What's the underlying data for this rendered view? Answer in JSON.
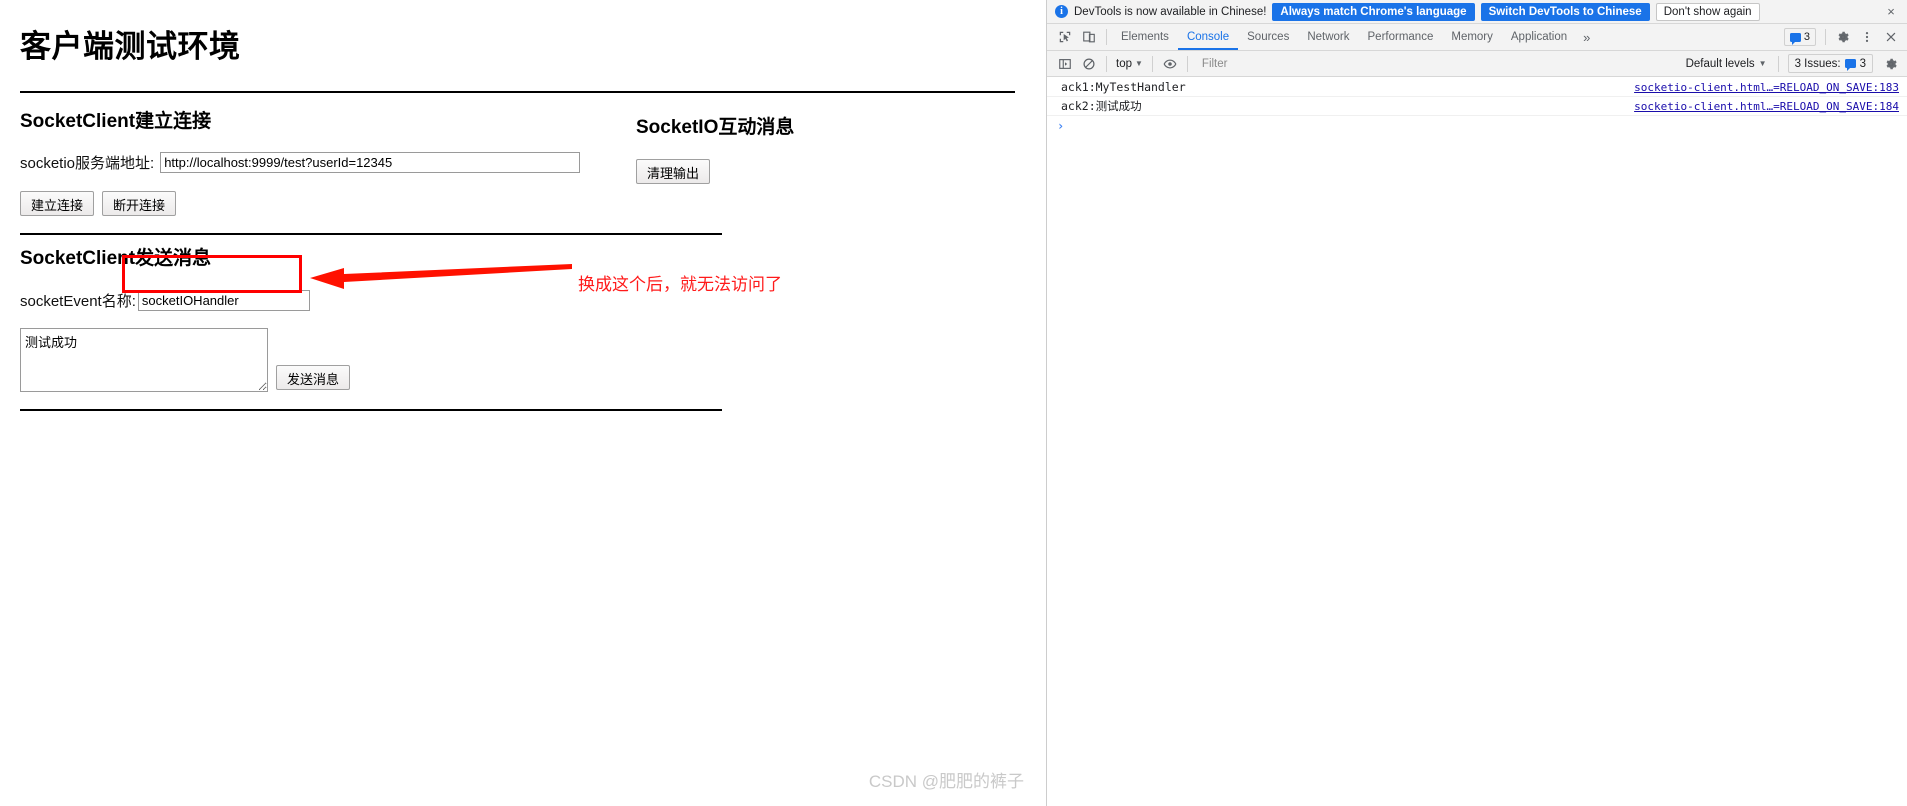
{
  "page": {
    "title": "客户端测试环境",
    "connect_section": {
      "heading": "SocketClient建立连接",
      "url_label": "socketio服务端地址:",
      "url_value": "http://localhost:9999/test?userId=12345",
      "url_placeholder": "",
      "connect_button": "建立连接",
      "disconnect_button": "断开连接"
    },
    "send_section": {
      "heading": "SocketClient发送消息",
      "event_label": "socketEvent名称:",
      "event_value": "socketIOHandler",
      "event_placeholder": "",
      "message_value": "测试成功",
      "message_placeholder": "",
      "send_button": "发送消息"
    },
    "io_section": {
      "heading": "SocketIO互动消息",
      "clear_button": "清理输出"
    },
    "annotation": {
      "text": "换成这个后，就无法访问了",
      "color": "#ff1a1a"
    },
    "highlight_color": "#ff0000",
    "watermark": "CSDN @肥肥的裤子"
  },
  "devtools": {
    "banner": {
      "message": "DevTools is now available in Chinese!",
      "primary_button": "Always match Chrome's language",
      "secondary_button": "Switch DevTools to Chinese",
      "dismiss_button": "Don't show again",
      "close_icon": "×",
      "info_icon": "info-icon",
      "accent_color": "#1a73e8"
    },
    "tabbar": {
      "inspect_icon": "inspect-element-icon",
      "device_icon": "device-toolbar-icon",
      "tabs": [
        {
          "label": "Elements",
          "active": false
        },
        {
          "label": "Console",
          "active": true
        },
        {
          "label": "Sources",
          "active": false
        },
        {
          "label": "Network",
          "active": false
        },
        {
          "label": "Performance",
          "active": false
        },
        {
          "label": "Memory",
          "active": false
        },
        {
          "label": "Application",
          "active": false
        }
      ],
      "more_icon": "»",
      "issues_count": "3",
      "settings_icon": "gear-icon",
      "menu_icon": "kebab-menu-icon",
      "close_icon": "×"
    },
    "console_toolbar": {
      "sidebar_icon": "console-sidebar-icon",
      "clear_icon": "clear-console-icon",
      "context": "top",
      "eye_icon": "live-expression-icon",
      "filter_placeholder": "Filter",
      "filter_value": "",
      "levels": "Default levels",
      "issues_label": "3 Issues:",
      "issues_count": "3",
      "settings_icon": "gear-icon"
    },
    "console_logs": [
      {
        "message": "ack1:MyTestHandler",
        "source": "socketio-client.html…=RELOAD_ON_SAVE:183"
      },
      {
        "message": "ack2:测试成功",
        "source": "socketio-client.html…=RELOAD_ON_SAVE:184"
      }
    ],
    "prompt_caret": "›"
  }
}
